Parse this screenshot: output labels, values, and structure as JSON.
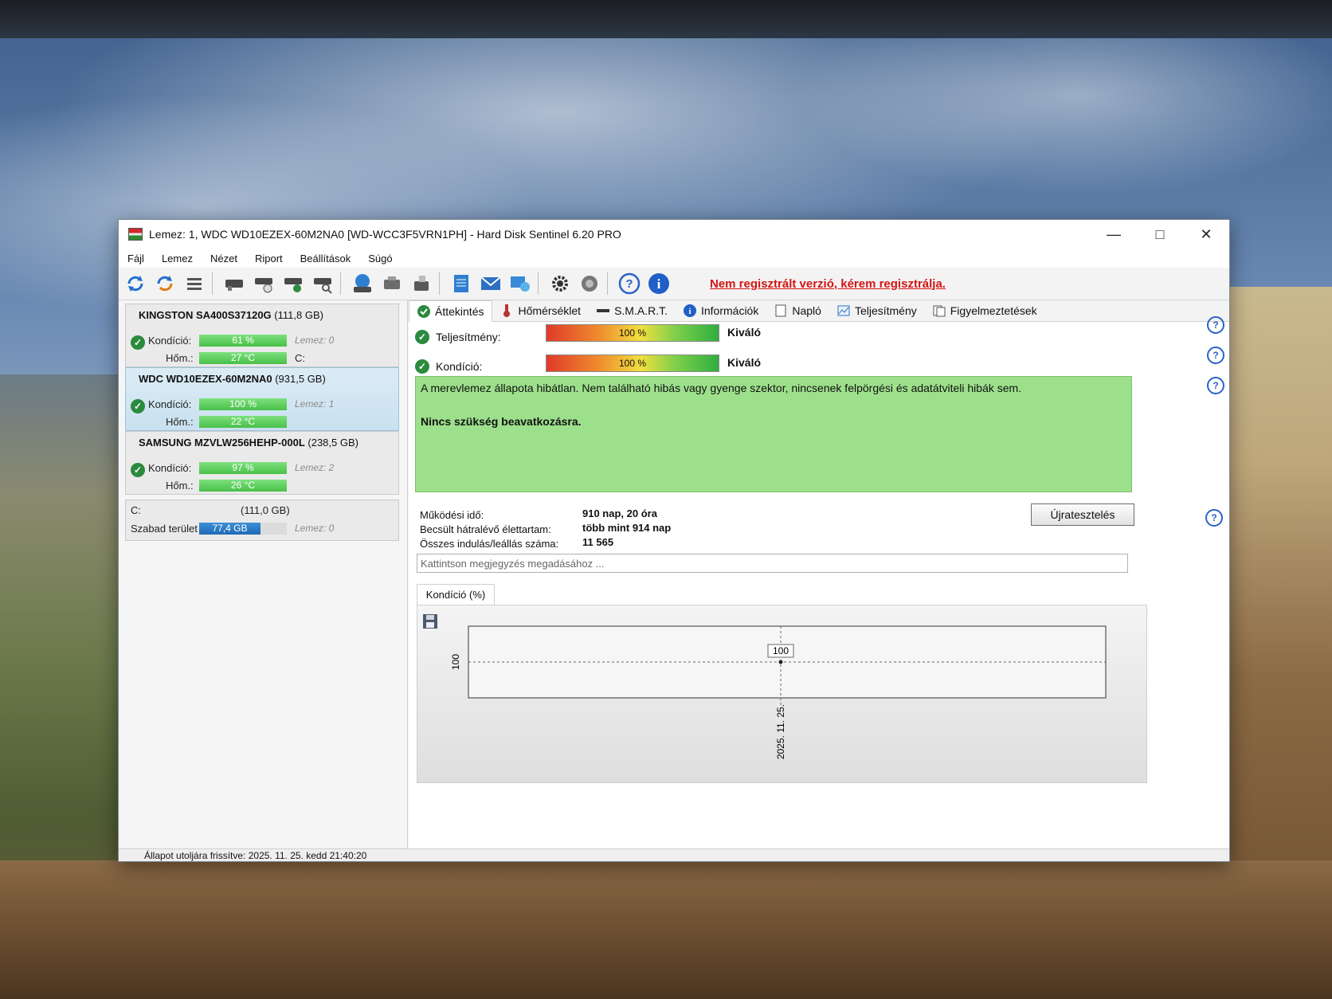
{
  "window": {
    "title": "Lemez: 1, WDC WD10EZEX-60M2NA0 [WD-WCC3F5VRN1PH]  -  Hard Disk Sentinel 6.20 PRO"
  },
  "menu": [
    "Fájl",
    "Lemez",
    "Nézet",
    "Riport",
    "Beállítások",
    "Súgó"
  ],
  "toolbar": {
    "register_notice": "Nem regisztrált verzió, kérem regisztrálja."
  },
  "disks": [
    {
      "name": "KINGSTON SA400S37120G",
      "size": "(111,8 GB)",
      "cond_label": "Kondíció:",
      "cond": "61 %",
      "cond_pct": 61,
      "temp_label": "Hőm.:",
      "temp": "27 °C",
      "lemez": "Lemez: 0",
      "drive": "C:"
    },
    {
      "name": "WDC WD10EZEX-60M2NA0",
      "size": "(931,5 GB)",
      "cond_label": "Kondíció:",
      "cond": "100 %",
      "cond_pct": 100,
      "temp_label": "Hőm.:",
      "temp": "22 °C",
      "lemez": "Lemez: 1",
      "drive": ""
    },
    {
      "name": "SAMSUNG MZVLW256HEHP-000L",
      "size": "(238,5 GB)",
      "cond_label": "Kondíció:",
      "cond": "97 %",
      "cond_pct": 97,
      "temp_label": "Hőm.:",
      "temp": "26 °C",
      "lemez": "Lemez: 2",
      "drive": ""
    }
  ],
  "volume": {
    "letter": "C:",
    "size": "(111,0 GB)",
    "free_label": "Szabad terület",
    "free": "77,4 GB",
    "free_pct": 70,
    "lemez": "Lemez: 0"
  },
  "tabs": [
    "Áttekintés",
    "Hőmérséklet",
    "S.M.A.R.T.",
    "Információk",
    "Napló",
    "Teljesítmény",
    "Figyelmeztetések"
  ],
  "overview": {
    "perf_label": "Teljesítmény:",
    "perf_value": "100 %",
    "perf_rating": "Kiváló",
    "cond_label": "Kondíció:",
    "cond_value": "100 %",
    "cond_rating": "Kiváló",
    "status_text": "A merevlemez állapota hibátlan. Nem található hibás vagy gyenge szektor, nincsenek felpörgési és adatátviteli hibák sem.",
    "status_action": "Nincs szükség beavatkozásra.",
    "uptime_label": "Működési idő:",
    "uptime": "910 nap, 20 óra",
    "remaining_label": "Becsült hátralévő élettartam:",
    "remaining": "több mint 914 nap",
    "starts_label": "Összes indulás/leállás száma:",
    "starts": "11 565",
    "retest_button": "Újratesztelés",
    "note_placeholder": "Kattintson megjegyzés megadásához ..."
  },
  "chart_data": {
    "type": "line",
    "title": "Kondíció  (%)",
    "x": [
      "2025. 11. 25."
    ],
    "series": [
      {
        "values": [
          100
        ]
      }
    ],
    "ytick_labels": [
      "100"
    ],
    "data_labels": [
      "100"
    ],
    "ylim": [
      99,
      101
    ]
  },
  "statusbar": {
    "text": "Állapot utoljára frissítve: 2025. 11. 25. kedd 21:40:20"
  },
  "colors": {
    "accent": "#2a62c9",
    "ok": "#2b8a3e",
    "warn_text": "#d41414",
    "status_bg": "#9de08c"
  }
}
